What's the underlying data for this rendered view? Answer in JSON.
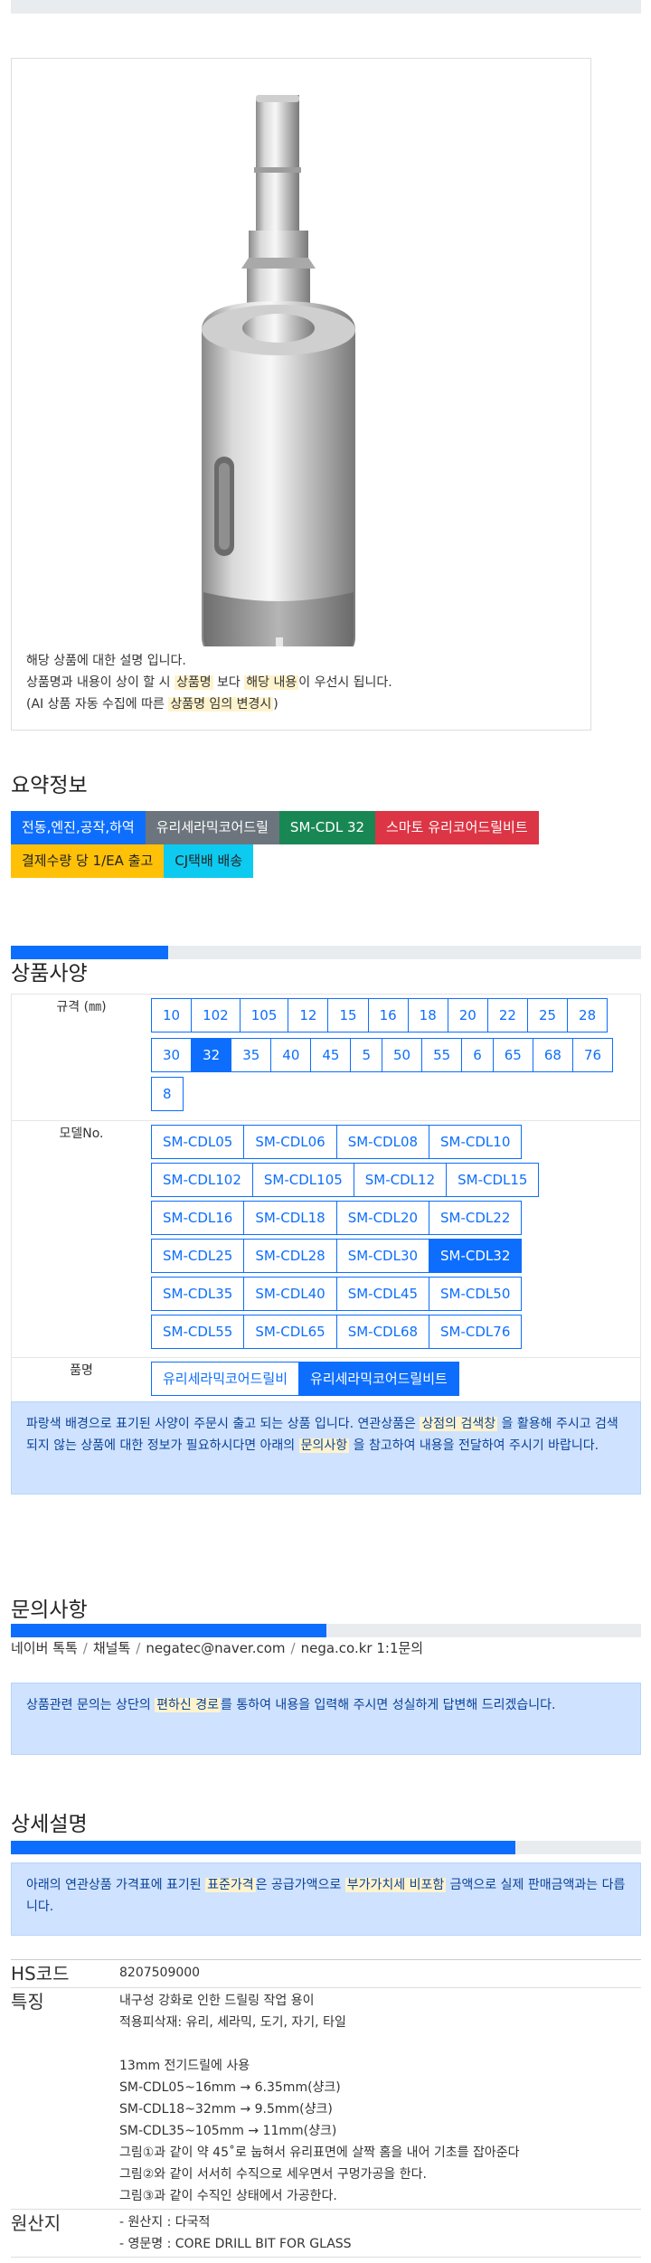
{
  "product_image": {
    "caption_line1": "해당 상품에 대한 설명 입니다.",
    "caption_line2_a": "상품명과 내용이 상이 할 시 ",
    "caption_line2_hl1": "상품명",
    "caption_line2_b": " 보다 ",
    "caption_line2_hl2": "해당 내용",
    "caption_line2_c": "이 우선시 됩니다.",
    "caption_line3_a": "(AI 상품 자동 수집에 따른 ",
    "caption_line3_hl": "상품명 임의 변경시",
    "caption_line3_b": ")"
  },
  "summary": {
    "title": "요약정보",
    "badges": [
      {
        "label": "전동,엔진,공작,하역",
        "color": "#0d6efd"
      },
      {
        "label": "유리세라믹코어드릴",
        "color": "#6c757d"
      },
      {
        "label": "SM-CDL 32",
        "color": "#198754"
      },
      {
        "label": "스마토 유리코어드릴비트",
        "color": "#dc3545"
      },
      {
        "label": "결제수량 당 1/EA 출고",
        "color": "#ffc107"
      },
      {
        "label": "CJ택배 배송",
        "color": "#0dcaf0"
      }
    ]
  },
  "spec": {
    "title": "상품사양",
    "progress_fraction": 0.25,
    "size_label": "규격 (㎜)",
    "sizes": [
      "10",
      "102",
      "105",
      "12",
      "15",
      "16",
      "18",
      "20",
      "22",
      "25",
      "28",
      "30",
      "32",
      "35",
      "40",
      "45",
      "5",
      "50",
      "55",
      "6",
      "65",
      "68",
      "76",
      "8"
    ],
    "size_selected": "32",
    "model_label": "모델No.",
    "models": [
      [
        "SM-CDL05",
        "SM-CDL06",
        "SM-CDL08",
        "SM-CDL10"
      ],
      [
        "SM-CDL102",
        "SM-CDL105",
        "SM-CDL12",
        "SM-CDL15"
      ],
      [
        "SM-CDL16",
        "SM-CDL18",
        "SM-CDL20",
        "SM-CDL22"
      ],
      [
        "SM-CDL25",
        "SM-CDL28",
        "SM-CDL30",
        "SM-CDL32"
      ],
      [
        "SM-CDL35",
        "SM-CDL40",
        "SM-CDL45",
        "SM-CDL50"
      ],
      [
        "SM-CDL55",
        "SM-CDL65",
        "SM-CDL68",
        "SM-CDL76"
      ]
    ],
    "model_selected": "SM-CDL32",
    "name_label": "품명",
    "names": [
      "유리세라믹코어드릴비",
      "유리세라믹코어드릴비트"
    ],
    "name_selected": "유리세라믹코어드릴비트",
    "notice_a": "파랑색 배경으로 표기된 사양이 주문시 출고 되는 상품 입니다. 연관상품은 ",
    "notice_hl1": "상점의 검색창",
    "notice_b": " 을 활용해 주시고 검색되지 않는 상품에 대한 정보가 필요하시다면 아래의 ",
    "notice_hl2": "문의사항",
    "notice_c": " 을 참고하여 내용을 전달하여 주시기 바랍니다."
  },
  "inquiry": {
    "title": "문의사항",
    "progress_fraction": 0.5,
    "contacts": [
      "네이버 톡톡",
      "채널톡",
      "negatec@naver.com",
      "nega.co.kr 1:1문의"
    ],
    "notice_a": "상품관련 문의는 상단의 ",
    "notice_hl": "편하신 경로",
    "notice_b": "를 통하여 내용을 입력해 주시면 성실하게 답변해 드리겠습니다."
  },
  "detail": {
    "title": "상세설명",
    "progress_fraction": 0.8,
    "notice_a": "아래의 연관상품 가격표에 표기된 ",
    "notice_hl1": "표준가격",
    "notice_b": "은 공급가액으로 ",
    "notice_hl2": "부가가치세 비포함",
    "notice_c": " 금액으로 실제 판매금액과는 다릅니다.",
    "rows": [
      {
        "key": "HS코드",
        "value": "8207509000"
      },
      {
        "key": "특징",
        "value": "내구성 강화로 인한 드릴링 작업 용이\n적용피삭재: 유리, 세라믹, 도기, 자기, 타일\n\n13mm 전기드릴에 사용\nSM-CDL05~16mm → 6.35mm(샹크)\nSM-CDL18~32mm → 9.5mm(샹크)\nSM-CDL35~105mm → 11mm(샹크)\n그림①과 같이 약 45˚로 눕혀서 유리표면에 살짝 홈을 내어 기초를 잡아준다\n그림②와 같이 서서히 수직으로 세우면서 구멍가공을 한다.\n그림③과 같이 수직인 상태에서 가공한다."
      },
      {
        "key": "원산지",
        "value": "- 원산지 : 다국적\n- 영문명 : CORE DRILL BIT FOR GLASS"
      }
    ]
  }
}
